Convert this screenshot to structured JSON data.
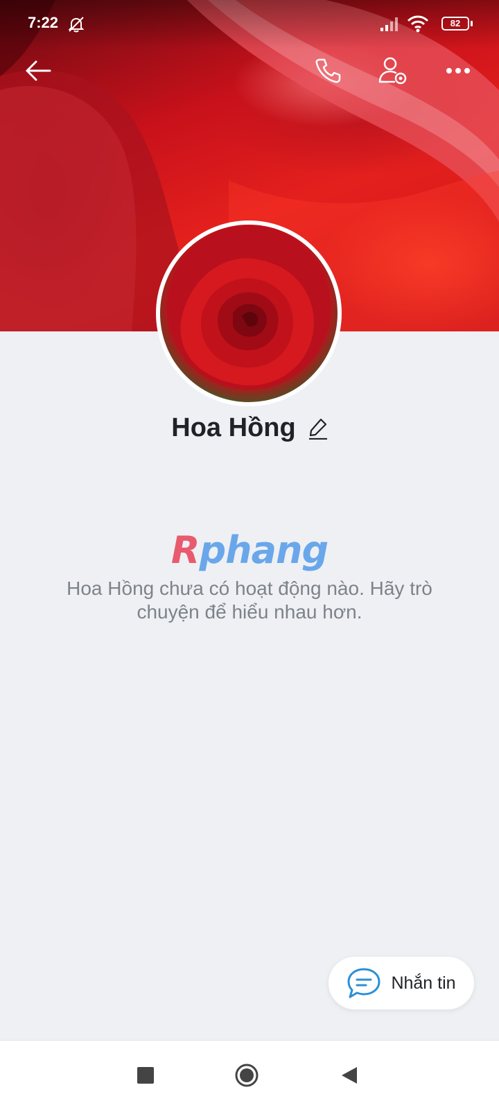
{
  "status_bar": {
    "time": "7:22",
    "battery": "82",
    "icons": [
      "mute-bell-icon",
      "signal-icon",
      "wifi-icon",
      "battery-icon"
    ]
  },
  "header": {
    "icons": [
      "back-arrow-icon",
      "phone-icon",
      "user-settings-icon",
      "more-icon"
    ]
  },
  "profile": {
    "name": "Hoa Hồng",
    "edit_icon": "pencil-icon"
  },
  "feed": {
    "logo_first": "R",
    "logo_rest": "phang",
    "empty_message": "Hoa Hồng chưa có hoạt động nào. Hãy trò chuyện để hiểu nhau hơn."
  },
  "message_button": {
    "label": "Nhắn tin",
    "icon": "chat-bubble-icon"
  },
  "nav": {
    "icons": [
      "recents-square-icon",
      "home-circle-icon",
      "back-triangle-icon"
    ]
  },
  "colors": {
    "accent": "#2c8fd6",
    "background": "#eff0f4",
    "cover": "#d0141c"
  }
}
